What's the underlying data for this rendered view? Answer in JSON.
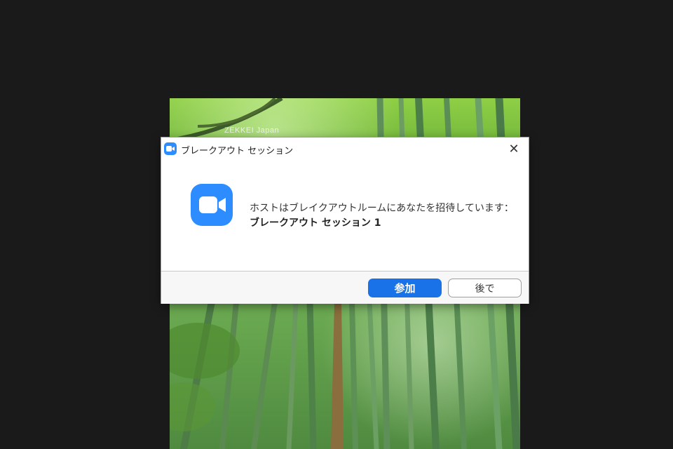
{
  "background": {
    "watermark": "ZEKKEI Japan"
  },
  "dialog": {
    "title": "ブレークアウト セッション",
    "message": "ホストはブレイクアウトルームにあなたを招待しています：",
    "session_name": "ブレークアウト セッション 1",
    "close_label": "✕",
    "join_label": "参加",
    "later_label": "後で"
  },
  "colors": {
    "brand": "#2d8cff",
    "primary_button": "#1a72e8"
  },
  "icons": {
    "app": "zoom-camera-icon",
    "close": "close-icon"
  }
}
